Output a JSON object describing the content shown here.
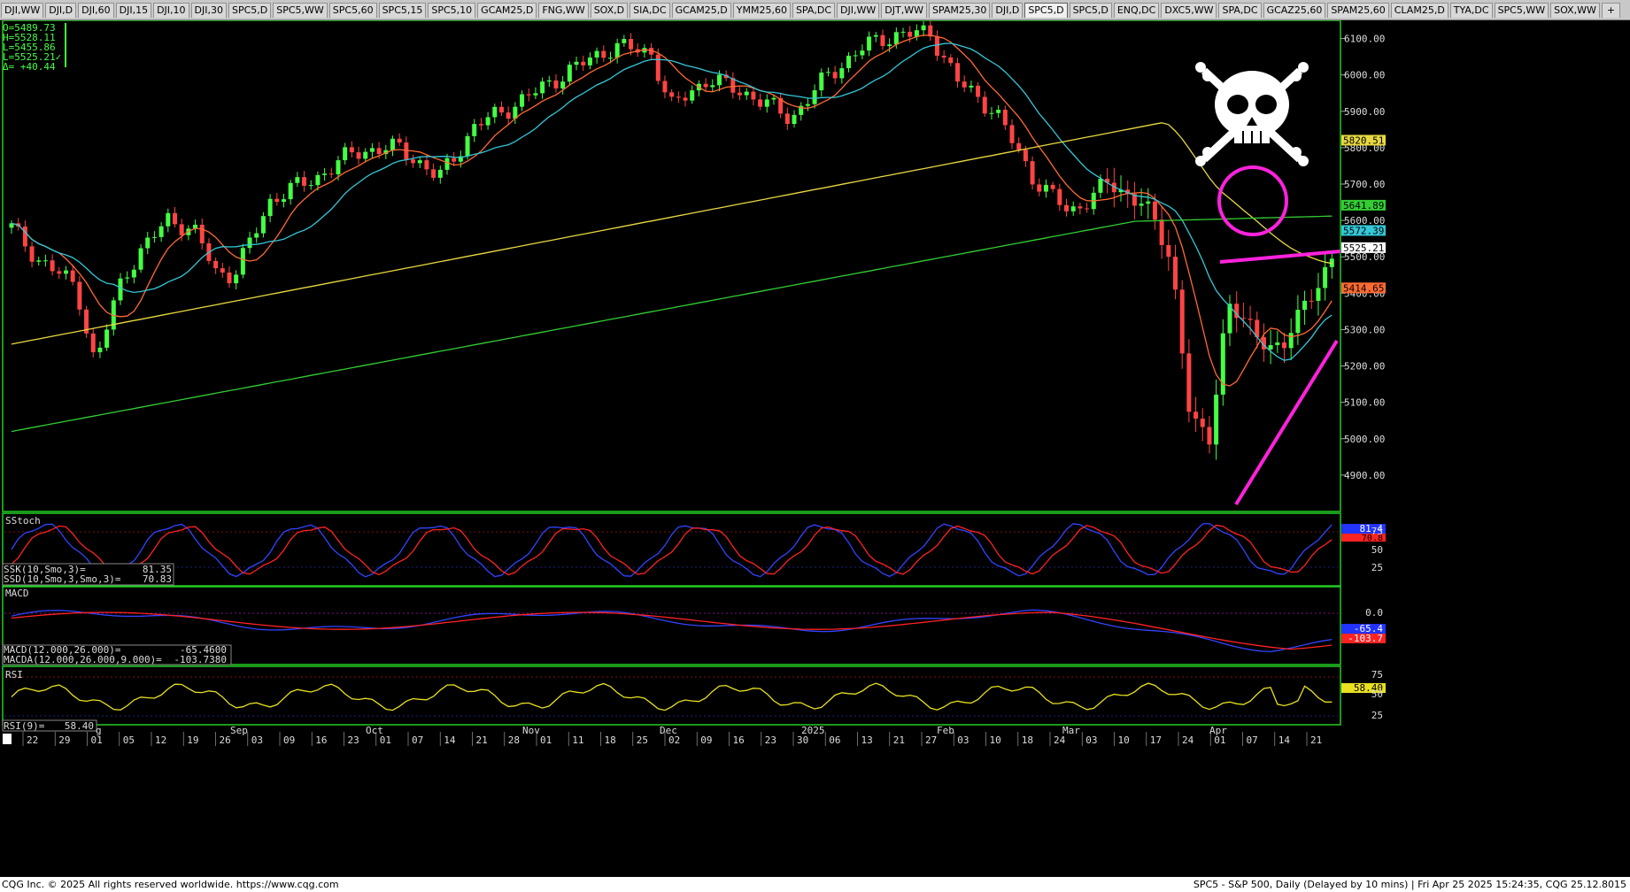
{
  "tabs": [
    "DJI,WW",
    "DJI,D",
    "DJI,60",
    "DJI,15",
    "DJI,10",
    "DJI,30",
    "SPC5,D",
    "SPC5,WW",
    "SPC5,60",
    "SPC5,15",
    "SPC5,10",
    "GCAM25,D",
    "FNG,WW",
    "SOX,D",
    "SIA,DC",
    "GCAM25,D",
    "YMM25,60",
    "SPA,DC",
    "DJI,WW",
    "DJT,WW",
    "SPAM25,30",
    "DJI,D",
    "SPC5,D",
    "SPC5,D",
    "ENQ,DC",
    "DXC5,WW",
    "SPA,DC",
    "GCAZ25,60",
    "SPAM25,60",
    "CLAM25,D",
    "TYA,DC",
    "SPC5,WW",
    "SOX,WW",
    "+"
  ],
  "active_tab": 22,
  "ohlc": {
    "open": "O=5489.73",
    "high": "H=5528.11",
    "low": "L=5455.86",
    "last": "L=5525.21✓",
    "change": "Δ= +40.44"
  },
  "status": {
    "left": "CQG Inc. © 2025 All rights reserved worldwide. https://www.cqg.com",
    "right": "SPC5 - S&P 500, Daily (Delayed by 10 mins) | Fri Apr 25 2025 15:24:35, CQG 25.12.8015"
  },
  "colors": {
    "up": "#44ff44",
    "down": "#ff4444",
    "ma10": "#ff6a33",
    "ma20": "#33c8d8",
    "ma50": "#e8d840",
    "ma200": "#33cc33",
    "magenta": "#ff22dd",
    "stoch_k": "#3344ff",
    "stoch_d": "#ff2222",
    "rsi": "#e8e020",
    "pane_border": "#22cc22"
  },
  "chart_data": {
    "type": "candlestick",
    "price_axis": {
      "ticks": [
        4900,
        5000,
        5100,
        5200,
        5300,
        5400,
        5500,
        5600,
        5700,
        5800,
        5900,
        6000,
        6100
      ],
      "tick_labels": [
        "4900.00",
        "5000.00",
        "5100.00",
        "5200.00",
        "5300.00",
        "5400.00",
        "5500.00",
        "5600.00",
        "5700.00",
        "5800.00",
        "5900.00",
        "6000.00",
        "6100.00"
      ]
    },
    "price_tags": [
      {
        "label": "5820.51",
        "value": 5820.51,
        "color": "#e8d840"
      },
      {
        "label": "5641.89",
        "value": 5641.89,
        "color": "#33cc33"
      },
      {
        "label": "5572.39",
        "value": 5572.39,
        "color": "#33c8d8"
      },
      {
        "label": "5525.21",
        "value": 5525.21,
        "color": "#ffffff"
      },
      {
        "label": "5414.65",
        "value": 5414.65,
        "color": "#ff6a33"
      }
    ],
    "date_labels": [
      "22",
      "29",
      "01",
      "05",
      "12",
      "19",
      "26",
      "03",
      "09",
      "16",
      "23",
      "01",
      "07",
      "14",
      "21",
      "28",
      "01",
      "11",
      "18",
      "25",
      "02",
      "09",
      "16",
      "23",
      "30",
      "06",
      "13",
      "21",
      "27",
      "03",
      "10",
      "18",
      "24",
      "03",
      "10",
      "17",
      "24",
      "01",
      "07",
      "14",
      "21"
    ],
    "month_labels": [
      "g",
      "Sep",
      "Oct",
      "Nov",
      "Dec",
      "2025",
      "Feb",
      "Mar",
      "Apr"
    ],
    "stoch": {
      "title": "SStoch",
      "k_label": "SSK(10,Smo,3)=",
      "k_value": "81.35",
      "d_label": "SSD(10,Smo,3,Smo,3)=",
      "d_value": "70.83",
      "k_tag": "81.4",
      "d_tag": "70.8",
      "axis": [
        "25",
        "50",
        "75"
      ]
    },
    "macd": {
      "title": "MACD",
      "macd_label": "MACD(12.000,26.000)=",
      "macd_value": "-65.4600",
      "signal_label": "MACDA(12.000,26.000,9.000)=",
      "signal_value": "-103.7380",
      "macd_tag": "-65.4",
      "signal_tag": "-103.7",
      "axis": [
        "0.0"
      ]
    },
    "rsi": {
      "title": "RSI",
      "label": "RSI(9)=",
      "value": "58.40",
      "tag": "58.40",
      "axis": [
        "25",
        "50",
        "75"
      ]
    },
    "annotations": [
      "skull-and-crossbones",
      "circle-around-ma-cross",
      "resistance-trendline",
      "support-trendline"
    ]
  }
}
